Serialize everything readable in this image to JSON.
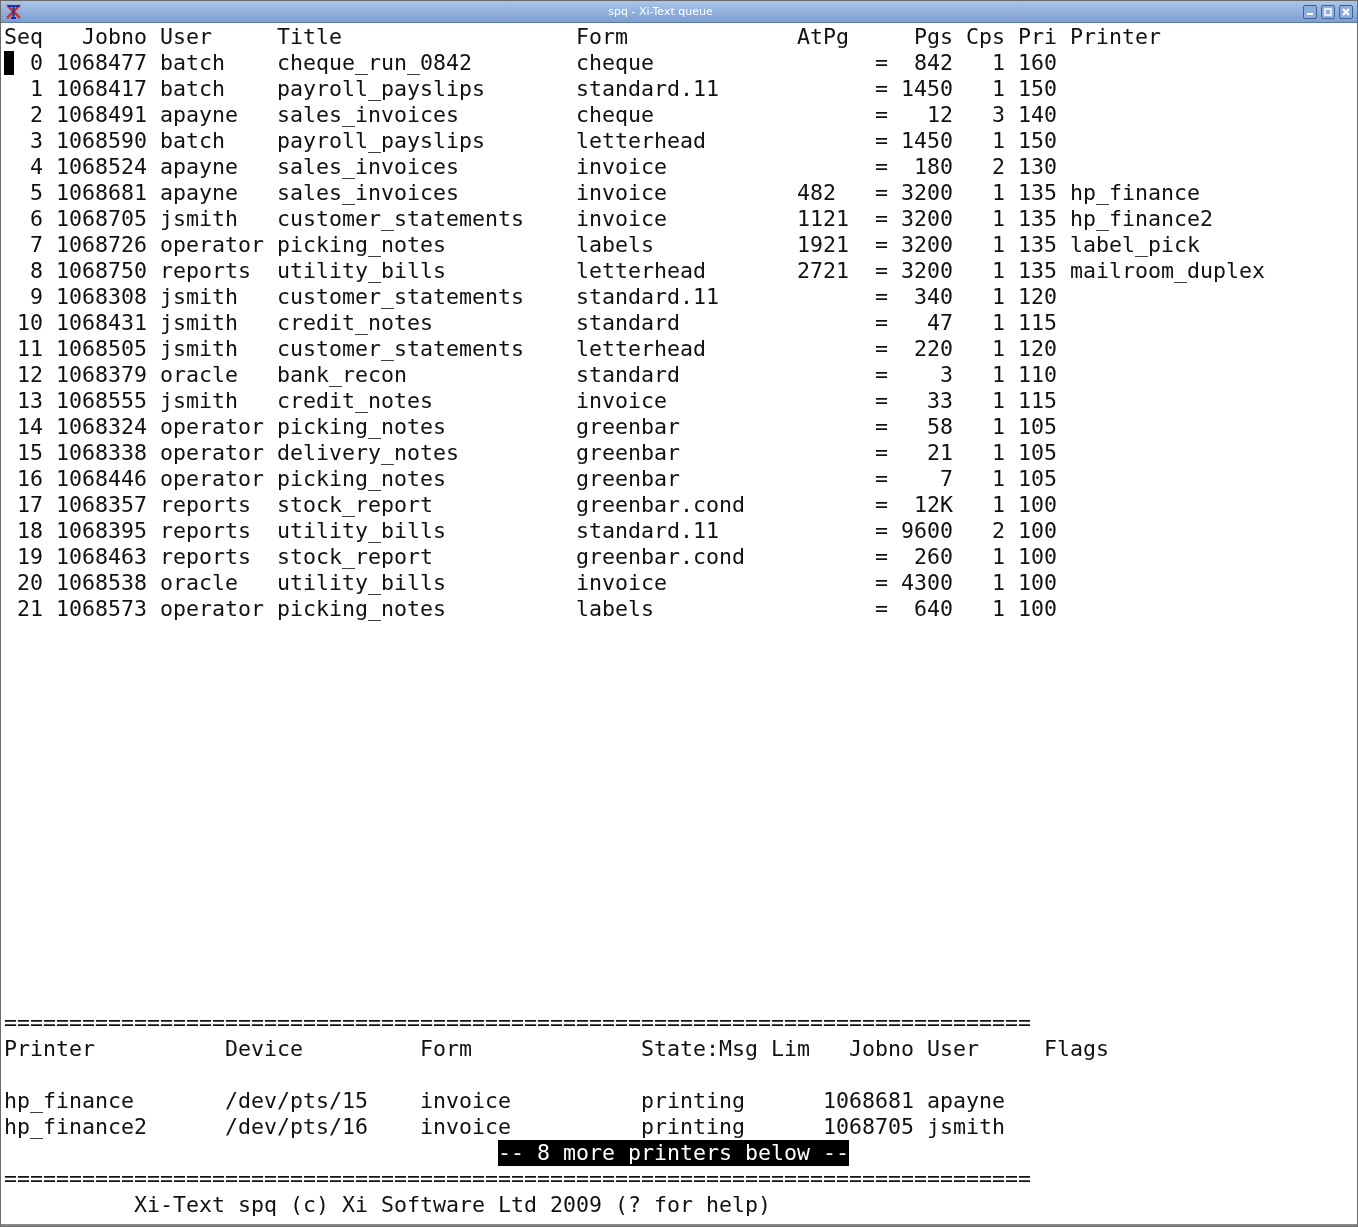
{
  "window": {
    "title": "spq - Xi-Text queue"
  },
  "jobs": {
    "columns": [
      "Seq",
      "Jobno",
      "User",
      "Title",
      "Form",
      "AtPg",
      "Pgs",
      "Cps",
      "Pri",
      "Printer"
    ],
    "rows": [
      {
        "selected": true,
        "seq": "0",
        "jobno": "1068477",
        "user": "batch",
        "title": "cheque_run_0842",
        "form": "cheque",
        "marker": "=",
        "pgs": "842",
        "cps": "1",
        "pri": "160"
      },
      {
        "selected": false,
        "seq": "1",
        "jobno": "1068417",
        "user": "batch",
        "title": "payroll_payslips",
        "form": "standard.11",
        "marker": "=",
        "pgs": "1450",
        "cps": "1",
        "pri": "150"
      },
      {
        "selected": false,
        "seq": "2",
        "jobno": "1068491",
        "user": "apayne",
        "title": "sales_invoices",
        "form": "cheque",
        "marker": "=",
        "pgs": "12",
        "cps": "3",
        "pri": "140"
      },
      {
        "selected": false,
        "seq": "3",
        "jobno": "1068590",
        "user": "batch",
        "title": "payroll_payslips",
        "form": "letterhead",
        "marker": "=",
        "pgs": "1450",
        "cps": "1",
        "pri": "150"
      },
      {
        "selected": false,
        "seq": "4",
        "jobno": "1068524",
        "user": "apayne",
        "title": "sales_invoices",
        "form": "invoice",
        "marker": "=",
        "pgs": "180",
        "cps": "2",
        "pri": "130"
      },
      {
        "selected": false,
        "seq": "5",
        "jobno": "1068681",
        "user": "apayne",
        "title": "sales_invoices",
        "form": "invoice",
        "atpg": "482",
        "marker": "=",
        "pgs": "3200",
        "cps": "1",
        "pri": "135",
        "printer": "hp_finance"
      },
      {
        "selected": false,
        "seq": "6",
        "jobno": "1068705",
        "user": "jsmith",
        "title": "customer_statements",
        "form": "invoice",
        "atpg": "1121",
        "marker": "=",
        "pgs": "3200",
        "cps": "1",
        "pri": "135",
        "printer": "hp_finance2"
      },
      {
        "selected": false,
        "seq": "7",
        "jobno": "1068726",
        "user": "operator",
        "title": "picking_notes",
        "form": "labels",
        "atpg": "1921",
        "marker": "=",
        "pgs": "3200",
        "cps": "1",
        "pri": "135",
        "printer": "label_pick"
      },
      {
        "selected": false,
        "seq": "8",
        "jobno": "1068750",
        "user": "reports",
        "title": "utility_bills",
        "form": "letterhead",
        "atpg": "2721",
        "marker": "=",
        "pgs": "3200",
        "cps": "1",
        "pri": "135",
        "printer": "mailroom_duplex"
      },
      {
        "selected": false,
        "seq": "9",
        "jobno": "1068308",
        "user": "jsmith",
        "title": "customer_statements",
        "form": "standard.11",
        "marker": "=",
        "pgs": "340",
        "cps": "1",
        "pri": "120"
      },
      {
        "selected": false,
        "seq": "10",
        "jobno": "1068431",
        "user": "jsmith",
        "title": "credit_notes",
        "form": "standard",
        "marker": "=",
        "pgs": "47",
        "cps": "1",
        "pri": "115"
      },
      {
        "selected": false,
        "seq": "11",
        "jobno": "1068505",
        "user": "jsmith",
        "title": "customer_statements",
        "form": "letterhead",
        "marker": "=",
        "pgs": "220",
        "cps": "1",
        "pri": "120"
      },
      {
        "selected": false,
        "seq": "12",
        "jobno": "1068379",
        "user": "oracle",
        "title": "bank_recon",
        "form": "standard",
        "marker": "=",
        "pgs": "3",
        "cps": "1",
        "pri": "110"
      },
      {
        "selected": false,
        "seq": "13",
        "jobno": "1068555",
        "user": "jsmith",
        "title": "credit_notes",
        "form": "invoice",
        "marker": "=",
        "pgs": "33",
        "cps": "1",
        "pri": "115"
      },
      {
        "selected": false,
        "seq": "14",
        "jobno": "1068324",
        "user": "operator",
        "title": "picking_notes",
        "form": "greenbar",
        "marker": "=",
        "pgs": "58",
        "cps": "1",
        "pri": "105"
      },
      {
        "selected": false,
        "seq": "15",
        "jobno": "1068338",
        "user": "operator",
        "title": "delivery_notes",
        "form": "greenbar",
        "marker": "=",
        "pgs": "21",
        "cps": "1",
        "pri": "105"
      },
      {
        "selected": false,
        "seq": "16",
        "jobno": "1068446",
        "user": "operator",
        "title": "picking_notes",
        "form": "greenbar",
        "marker": "=",
        "pgs": "7",
        "cps": "1",
        "pri": "105"
      },
      {
        "selected": false,
        "seq": "17",
        "jobno": "1068357",
        "user": "reports",
        "title": "stock_report",
        "form": "greenbar.cond",
        "marker": "=",
        "pgs": "12K",
        "cps": "1",
        "pri": "100"
      },
      {
        "selected": false,
        "seq": "18",
        "jobno": "1068395",
        "user": "reports",
        "title": "utility_bills",
        "form": "standard.11",
        "marker": "=",
        "pgs": "9600",
        "cps": "2",
        "pri": "100"
      },
      {
        "selected": false,
        "seq": "19",
        "jobno": "1068463",
        "user": "reports",
        "title": "stock_report",
        "form": "greenbar.cond",
        "marker": "=",
        "pgs": "260",
        "cps": "1",
        "pri": "100"
      },
      {
        "selected": false,
        "seq": "20",
        "jobno": "1068538",
        "user": "oracle",
        "title": "utility_bills",
        "form": "invoice",
        "marker": "=",
        "pgs": "4300",
        "cps": "1",
        "pri": "100"
      },
      {
        "selected": false,
        "seq": "21",
        "jobno": "1068573",
        "user": "operator",
        "title": "picking_notes",
        "form": "labels",
        "marker": "=",
        "pgs": "640",
        "cps": "1",
        "pri": "100"
      }
    ]
  },
  "printers": {
    "rule_above": "===============================================================================",
    "columns": [
      "Printer",
      "Device",
      "Form",
      "State:Msg",
      "Lim",
      "Jobno",
      "User",
      "Flags"
    ],
    "rows": [
      {
        "printer": "hp_finance",
        "device": "/dev/pts/15",
        "form": "invoice",
        "state": "printing",
        "jobno": "1068681",
        "user": "apayne"
      },
      {
        "printer": "hp_finance2",
        "device": "/dev/pts/16",
        "form": "invoice",
        "state": "printing",
        "jobno": "1068705",
        "user": "jsmith"
      }
    ],
    "more_notice": "-- 8 more printers below --",
    "rule_below": "==============================================================================="
  },
  "status_bar": "Xi-Text spq (c) Xi Software Ltd 2009 (? for help)"
}
